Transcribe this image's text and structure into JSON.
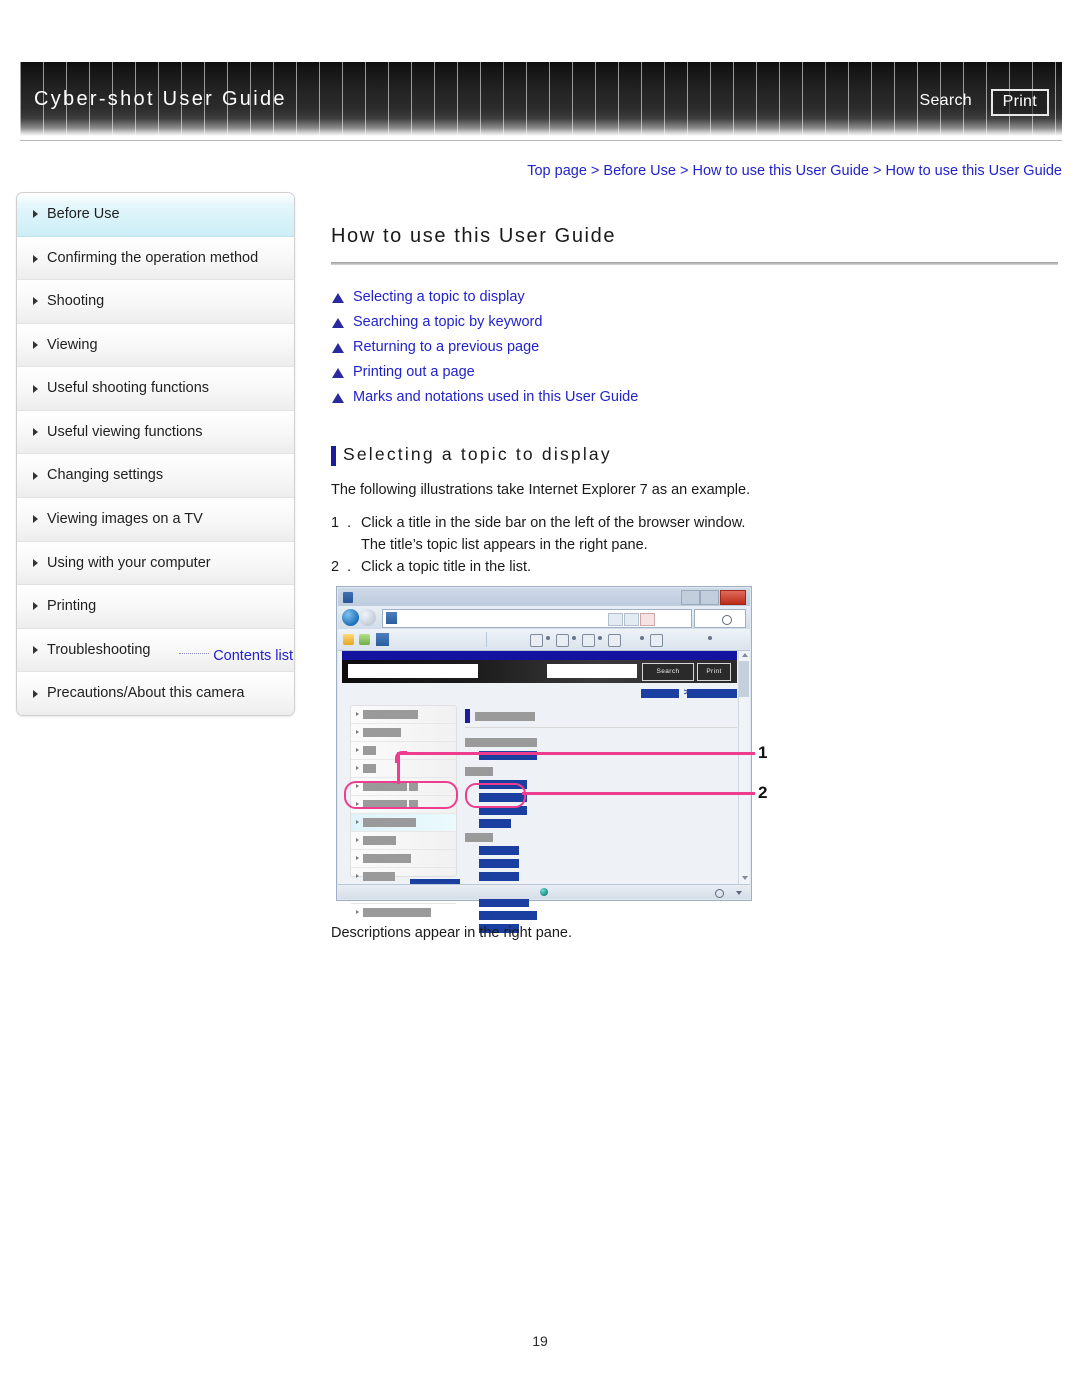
{
  "header": {
    "title": "Cyber-shot User Guide",
    "search_label": "Search",
    "print_label": "Print"
  },
  "breadcrumb": "Top page > Before Use > How to use this User Guide > How to use this User Guide",
  "sidebar": {
    "items": [
      {
        "label": "Before Use",
        "active": true
      },
      {
        "label": "Confirming the operation method",
        "active": false
      },
      {
        "label": "Shooting",
        "active": false
      },
      {
        "label": "Viewing",
        "active": false
      },
      {
        "label": "Useful shooting functions",
        "active": false
      },
      {
        "label": "Useful viewing functions",
        "active": false
      },
      {
        "label": "Changing settings",
        "active": false
      },
      {
        "label": "Viewing images on a TV",
        "active": false
      },
      {
        "label": "Using with your computer",
        "active": false
      },
      {
        "label": "Printing",
        "active": false
      },
      {
        "label": "Troubleshooting",
        "active": false
      },
      {
        "label": "Precautions/About this camera",
        "active": false
      }
    ],
    "contents_link": "Contents list"
  },
  "main": {
    "page_title": "How to use this User Guide",
    "jump_links": [
      "Selecting a topic to display",
      "Searching a topic by keyword",
      "Returning to a previous page",
      "Printing out a page",
      "Marks and notations used in this User Guide"
    ],
    "section_heading": "Selecting a topic to display",
    "intro": "The following illustrations take Internet Explorer 7 as an example.",
    "steps": [
      {
        "num": "1 .",
        "line1": "Click a title in the side bar on the left of the browser window.",
        "line2": "The title’s topic list appears in the right pane."
      },
      {
        "num": "2 .",
        "line1": "Click a topic title in the list.",
        "line2": ""
      }
    ],
    "outro": "Descriptions appear in the right pane.",
    "illustration": {
      "site_search_label": "Search",
      "site_print_label": "Print",
      "callout_1": "1",
      "callout_2": "2"
    }
  },
  "page_number": "19",
  "colors": {
    "link_blue": "#2222cc",
    "accent_navy": "#1b1b9c",
    "callout_pink": "#ee3d8f",
    "sidebar_highlight": "#cdeef7",
    "header_dark": "#141414"
  }
}
